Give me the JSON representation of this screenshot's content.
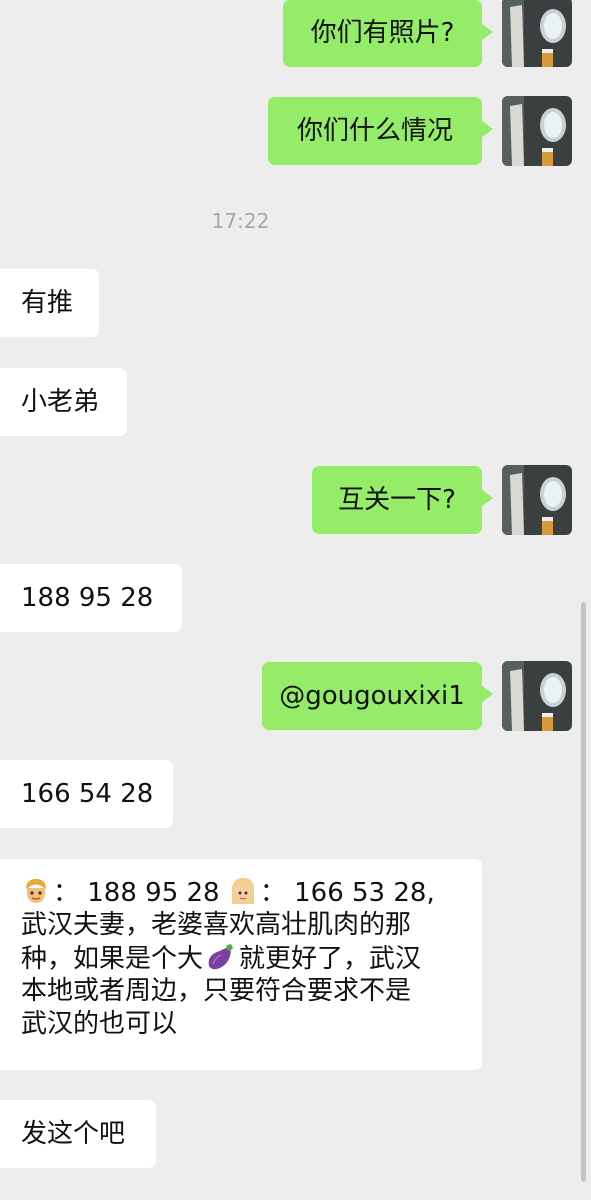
{
  "timestamp": "17:22",
  "messages": {
    "m1": "你们有照片?",
    "m2": "你们什么情况",
    "m3": "有推",
    "m4": "小老弟",
    "m5": "互关一下?",
    "m6": "188 95 28",
    "m7": "@gougouxixi1",
    "m8": "166 54 28",
    "m9": {
      "seg_husband": "：  188 95 28 ",
      "seg_wife": "：  166 53 28,",
      "line2": "武汉夫妻，老婆喜欢高壮肌肉的那",
      "line3_a": "种，如果是个大",
      "line3_b": "就更好了，武汉",
      "line4": "本地或者周边，只要符合要求不是",
      "line5": "武汉的也可以"
    },
    "m10": "发这个吧"
  },
  "icons": {
    "man": "man-emoji-icon",
    "woman": "woman-blond-emoji-icon",
    "eggplant": "eggplant-emoji-icon",
    "avatar": "airplane-window-avatar"
  },
  "colors": {
    "background": "#ededed",
    "outgoing_bubble": "#95ec69",
    "incoming_bubble": "#ffffff",
    "timestamp": "#a8a8a8"
  }
}
